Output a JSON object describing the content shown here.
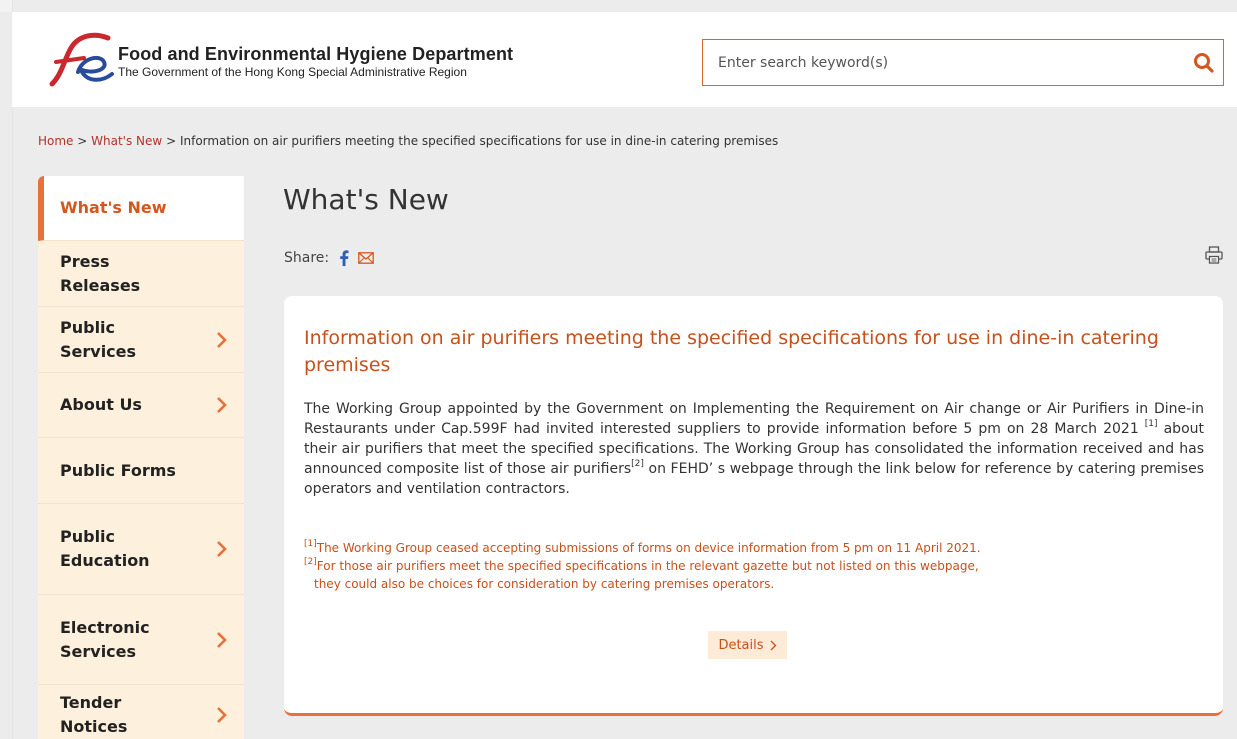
{
  "header": {
    "dept_name": "Food and Environmental Hygiene Department",
    "gov_name": "The Government of the Hong Kong Special Administrative Region",
    "logo_icon": "fehd-logo-icon"
  },
  "search": {
    "placeholder": "Enter search keyword(s)",
    "icon": "search-icon"
  },
  "breadcrumb": {
    "home": "Home",
    "separator": ">",
    "whats_new": "What's New",
    "current": "Information on air purifiers meeting the specified specifications for use in dine-in catering premises"
  },
  "sidebar": {
    "items": [
      {
        "label": "What's New",
        "active": true,
        "has_submenu": false
      },
      {
        "label": "Press Releases",
        "active": false,
        "has_submenu": false
      },
      {
        "label": "Public Services",
        "active": false,
        "has_submenu": true
      },
      {
        "label": "About Us",
        "active": false,
        "has_submenu": true
      },
      {
        "label": "Public Forms",
        "active": false,
        "has_submenu": false
      },
      {
        "label": "Public Education",
        "active": false,
        "has_submenu": true
      },
      {
        "label": "Electronic Services",
        "active": false,
        "has_submenu": true
      },
      {
        "label": "Tender Notices",
        "active": false,
        "has_submenu": true
      }
    ]
  },
  "main": {
    "page_title": "What's New",
    "share_label": "Share:",
    "card": {
      "title": "Information on air purifiers meeting the specified specifications for use in dine-in catering premises",
      "body_1": "The Working Group appointed by the Government on Implementing the Requirement on Air change or Air Purifiers in Dine-in Restaurants under Cap.599F had invited interested suppliers to provide information before 5 pm on 28 March 2021 ",
      "ref_1": "[1]",
      "body_2": " about their air purifiers that meet the specified specifications. The Working Group has consolidated the information received and has announced composite list of those air purifiers",
      "ref_2": "[2]",
      "body_3": " on FEHD’ s webpage through the link below for reference by catering premises operators and ventilation contractors.",
      "note_1_ref": "[1]",
      "note_1": "The Working Group ceased accepting submissions of forms on device information from 5 pm on 11 April 2021.",
      "note_2_ref": "[2]",
      "note_2_a": "For those air purifiers meet the specified specifications in the relevant gazette but not listed on this webpage,",
      "note_2_b": "they could also be choices for consideration by catering premises operators.",
      "details_label": "Details"
    }
  },
  "colors": {
    "accent": "#e8703a",
    "title_orange": "#c8501a",
    "breadcrumb_link": "#b0332a",
    "sidebar_bg": "#fdf0dc",
    "page_bg": "#ececec"
  }
}
